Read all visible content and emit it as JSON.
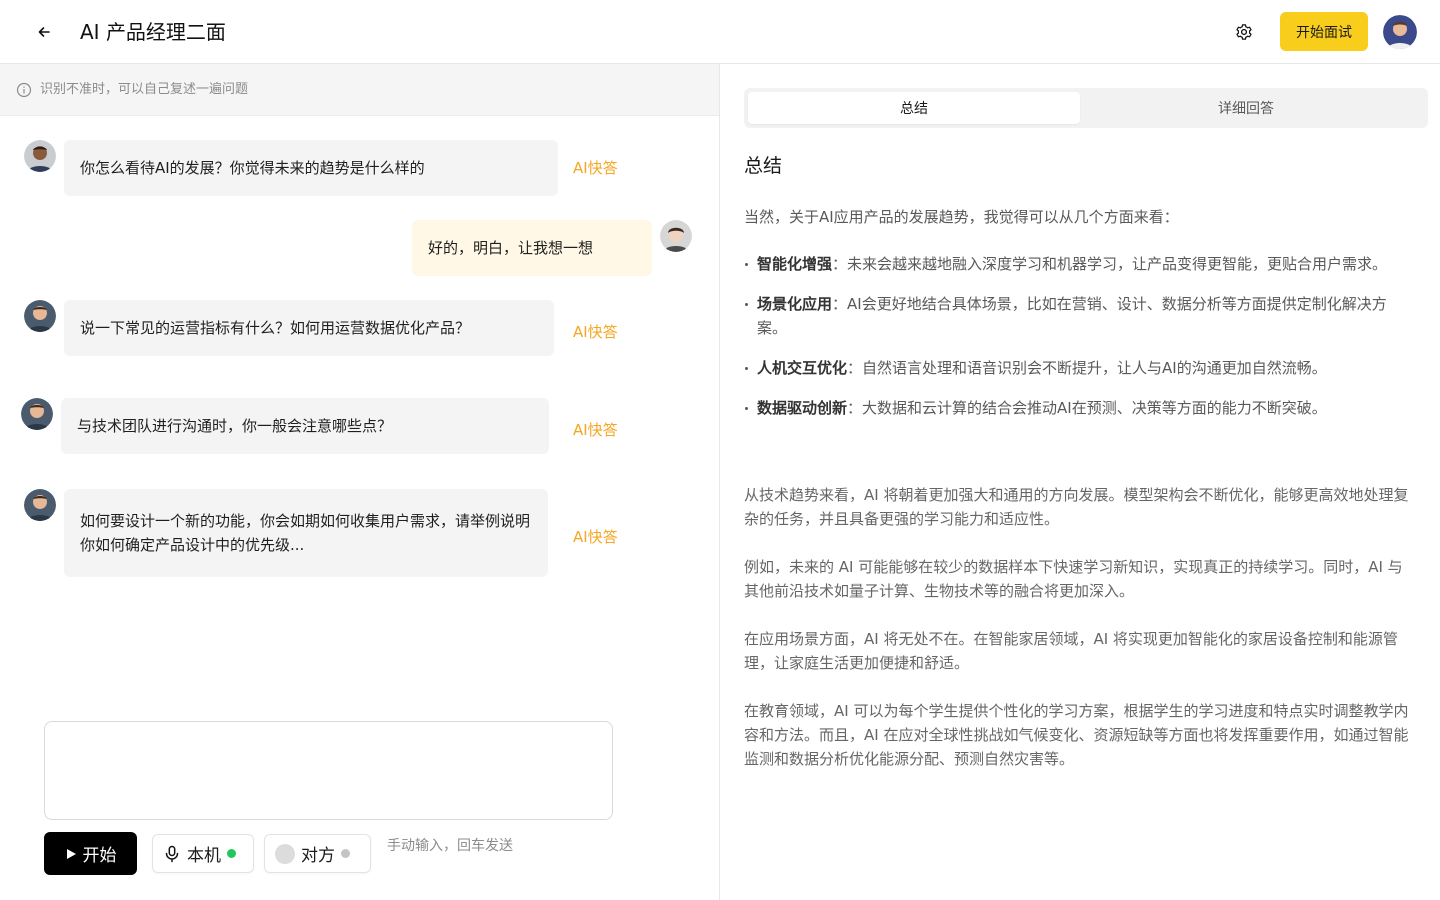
{
  "header": {
    "title": "AI 产品经理二面",
    "start_interview_label": "开始面试"
  },
  "colors": {
    "accent_yellow": "#f9cd1b",
    "quick_answer": "#f5a623",
    "status_green": "#22c55e",
    "status_grey": "#c4c4c4"
  },
  "hint": {
    "text": "识别不准时，可以自己复述一遍问题"
  },
  "messages": [
    {
      "role": "interviewer",
      "text": "你怎么看待AI的发展？你觉得未来的趋势是什么样的",
      "action": "AI快答"
    },
    {
      "role": "self",
      "text": "好的，明白，让我想一想"
    },
    {
      "role": "interviewer",
      "text": "说一下常见的运营指标有什么？如何用运营数据优化产品？",
      "action": "AI快答"
    },
    {
      "role": "interviewer",
      "text": "与技术团队进行沟通时，你一般会注意哪些点？",
      "action": "AI快答"
    },
    {
      "role": "interviewer",
      "text": "如何要设计一个新的功能，你会如期如何收集用户需求，请举例说明你如何确定产品设计中的优先级...",
      "action": "AI快答"
    }
  ],
  "input": {
    "placeholder": ""
  },
  "controls": {
    "start_label": "开始",
    "local_label": "本机",
    "remote_label": "对方",
    "hint": "手动输入，回车发送"
  },
  "tabs": [
    {
      "label": "总结",
      "active": true
    },
    {
      "label": "详细回答",
      "active": false
    }
  ],
  "summary": {
    "heading": "总结",
    "intro": "当然，关于AI应用产品的发展趋势，我觉得可以从几个方面来看：",
    "bullets": [
      {
        "title": "智能化增强",
        "text": "：未来会越来越地融入深度学习和机器学习，让产品变得更智能，更贴合用户需求。"
      },
      {
        "title": "场景化应用",
        "text": "：AI会更好地结合具体场景，比如在营销、设计、数据分析等方面提供定制化解决方案。"
      },
      {
        "title": "人机交互优化",
        "text": "：自然语言处理和语音识别会不断提升，让人与AI的沟通更加自然流畅。"
      },
      {
        "title": "数据驱动创新",
        "text": "：大数据和云计算的结合会推动AI在预测、决策等方面的能力不断突破。"
      }
    ],
    "paragraphs": [
      "从技术趋势来看，AI 将朝着更加强大和通用的方向发展。模型架构会不断优化，能够更高效地处理复杂的任务，并且具备更强的学习能力和适应性。",
      "例如，未来的 AI 可能能够在较少的数据样本下快速学习新知识，实现真正的持续学习。同时，AI 与其他前沿技术如量子计算、生物技术等的融合将更加深入。",
      "在应用场景方面，AI 将无处不在。在智能家居领域，AI 将实现更加智能化的家居设备控制和能源管理，让家庭生活更加便捷和舒适。",
      "在教育领域，AI 可以为每个学生提供个性化的学习方案，根据学生的学习进度和特点实时调整教学内容和方法。而且，AI 在应对全球性挑战如气候变化、资源短缺等方面也将发挥重要作用，如通过智能监测和数据分析优化能源分配、预测自然灾害等。"
    ]
  }
}
